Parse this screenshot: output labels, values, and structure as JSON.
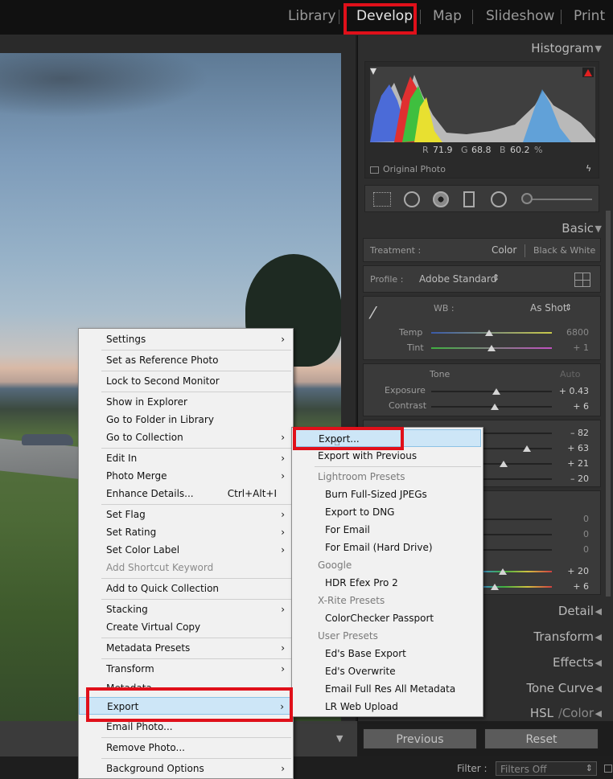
{
  "modules": [
    "Library",
    "Develop",
    "Map",
    "Slideshow",
    "Print"
  ],
  "histogram": {
    "title": "Histogram",
    "r_label": "R",
    "r": "71.9",
    "g_label": "G",
    "g": "68.8",
    "b_label": "B",
    "b": "60.2",
    "pct": "%",
    "original": "Original Photo"
  },
  "basic": {
    "title": "Basic",
    "treatment_label": "Treatment :",
    "treat_color": "Color",
    "treat_bw": "Black & White",
    "profile_label": "Profile :",
    "profile_value": "Adobe Standard",
    "wb_label": "WB :",
    "wb_value": "As Shot",
    "temp_label": "Temp",
    "temp_value": "6800",
    "tint_label": "Tint",
    "tint_value": "+ 1",
    "tone_label": "Tone",
    "auto_label": "Auto",
    "exposure_label": "Exposure",
    "exposure_value": "+ 0.43",
    "contrast_label": "Contrast",
    "contrast_value": "+ 6",
    "v1": "– 82",
    "v2": "+ 63",
    "v3": "+ 21",
    "v4": "– 20",
    "v5": "0",
    "v6": "0",
    "v7": "0",
    "v8": "+ 20",
    "v9": "+ 6"
  },
  "panels": {
    "detail": "Detail",
    "transform": "Transform",
    "effects": "Effects",
    "tone_curve": "Tone Curve",
    "hsl": "HSL",
    "color": "Color"
  },
  "buttons": {
    "previous": "Previous",
    "reset": "Reset"
  },
  "filter": {
    "label": "Filter :",
    "value": "Filters Off"
  },
  "context_menu": {
    "settings": "Settings",
    "set_reference": "Set as Reference Photo",
    "lock_monitor": "Lock to Second Monitor",
    "show_explorer": "Show in Explorer",
    "go_folder": "Go to Folder in Library",
    "go_collection": "Go to Collection",
    "edit_in": "Edit In",
    "photo_merge": "Photo Merge",
    "enhance": "Enhance Details...",
    "enhance_sc": "Ctrl+Alt+I",
    "set_flag": "Set Flag",
    "set_rating": "Set Rating",
    "set_color": "Set Color Label",
    "add_shortcut": "Add Shortcut Keyword",
    "add_quick": "Add to Quick Collection",
    "stacking": "Stacking",
    "virtual_copy": "Create Virtual Copy",
    "metadata_presets": "Metadata Presets",
    "transform": "Transform",
    "metadata": "Metadata",
    "export": "Export",
    "email": "Email Photo...",
    "remove": "Remove Photo...",
    "background": "Background Options"
  },
  "export_menu": {
    "export": "Export...",
    "export_prev": "Export with Previous",
    "lr_presets": "Lightroom Presets",
    "burn": "Burn Full-Sized JPEGs",
    "dng": "Export to DNG",
    "for_email": "For Email",
    "for_email_hd": "For Email (Hard Drive)",
    "google": "Google",
    "hdr": "HDR Efex Pro 2",
    "xrite": "X-Rite Presets",
    "colorchecker": "ColorChecker Passport",
    "user_presets": "User Presets",
    "eds_base": "Ed's Base Export",
    "eds_over": "Ed's Overwrite",
    "email_full": "Email Full Res All Metadata",
    "lr_web": "LR Web Upload"
  }
}
